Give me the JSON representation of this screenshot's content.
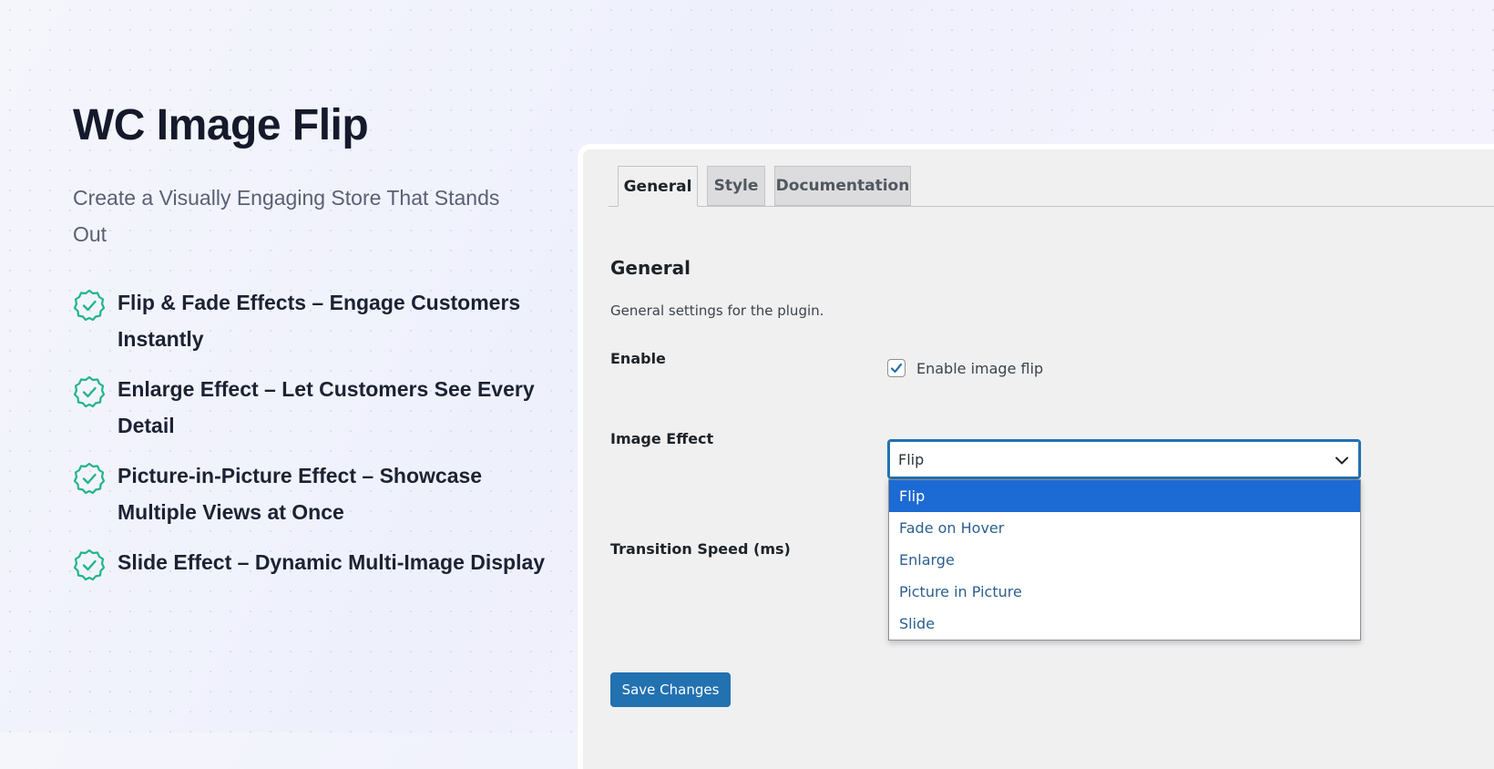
{
  "hero": {
    "title": "WC Image Flip",
    "subtitle": "Create a Visually Engaging Store That Stands Out",
    "features": [
      {
        "text": "Flip & Fade Effects – Engage Customers Instantly",
        "icon": "check-badge-icon"
      },
      {
        "text": "Enlarge Effect – Let Customers See Every Detail",
        "icon": "check-badge-icon"
      },
      {
        "text": "Picture-in-Picture Effect – Showcase Multiple Views at Once",
        "icon": "check-badge-icon"
      },
      {
        "text": "Slide Effect – Dynamic Multi-Image Display",
        "icon": "check-badge-icon"
      }
    ],
    "accent_color": "#22b58a"
  },
  "settings": {
    "tabs": [
      {
        "label": "General",
        "active": true
      },
      {
        "label": "Style",
        "active": false
      },
      {
        "label": "Documentation",
        "active": false
      }
    ],
    "section_title": "General",
    "section_description": "General settings for the plugin.",
    "enable": {
      "label": "Enable",
      "checkbox_label": "Enable image flip",
      "checked": true
    },
    "image_effect": {
      "label": "Image Effect",
      "selected": "Flip",
      "options": [
        "Flip",
        "Fade on Hover",
        "Enlarge",
        "Picture in Picture",
        "Slide"
      ]
    },
    "transition_speed": {
      "label": "Transition Speed (ms)"
    },
    "save_button": "Save Changes",
    "primary_color": "#2271b1"
  }
}
